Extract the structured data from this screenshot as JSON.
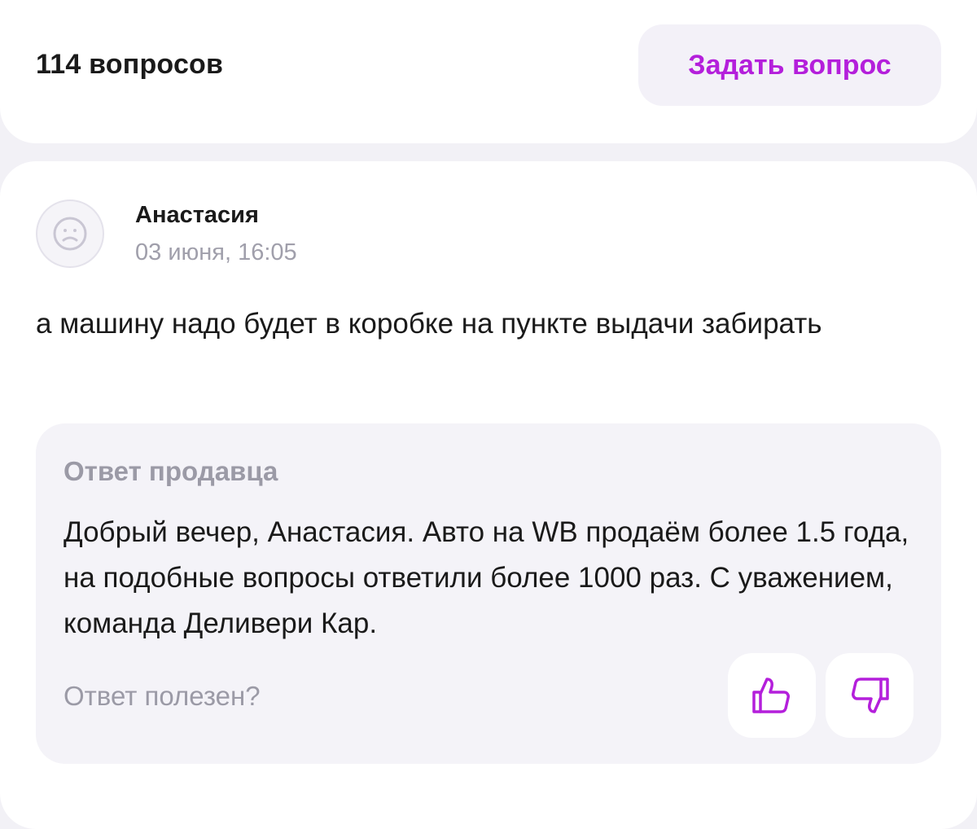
{
  "header": {
    "questions_count": "114 вопросов",
    "ask_button_label": "Задать вопрос"
  },
  "question": {
    "author": "Анастасия",
    "date": "03 июня, 16:05",
    "text": "а машину надо будет в коробке на пункте выдачи забирать",
    "avatar_icon": "sad-face-icon",
    "answer": {
      "title": "Ответ продавца",
      "text": "Добрый вечер, Анастасия. Авто на WB продаём более 1.5 года, на подобные вопросы ответили более 1000 раз. С уважением, команда Деливери Кар.",
      "helpful_prompt": "Ответ полезен?",
      "thumbs_up_icon": "thumbs-up-icon",
      "thumbs_down_icon": "thumbs-down-icon"
    }
  },
  "colors": {
    "accent": "#b41fdb",
    "muted_text": "#9b9aa6",
    "page_background": "#f2f1f6"
  }
}
